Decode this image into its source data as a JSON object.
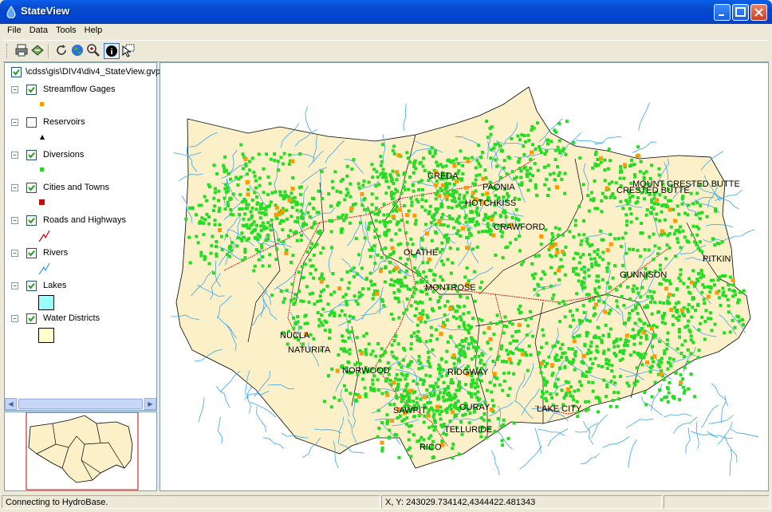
{
  "window": {
    "title": "StateView"
  },
  "menu": [
    "File",
    "Data",
    "Tools",
    "Help"
  ],
  "toolbar": {
    "buttons": [
      "print-icon",
      "export-icon",
      "refresh-icon",
      "globe-icon",
      "zoom-icon",
      "info-icon",
      "select-icon"
    ]
  },
  "legend": {
    "root": "\\cdss\\gis\\DIV4\\div4_StateView.gvp",
    "layers": [
      {
        "name": "Streamflow Gages",
        "checked": true,
        "symbol": "point",
        "color": "#ff9900"
      },
      {
        "name": "Reservoirs",
        "checked": false,
        "symbol": "triangle",
        "color": "#000000"
      },
      {
        "name": "Diversions",
        "checked": true,
        "symbol": "point",
        "color": "#33cc33"
      },
      {
        "name": "Cities and Towns",
        "checked": true,
        "symbol": "square",
        "color": "#dd0000"
      },
      {
        "name": "Roads and Highways",
        "checked": true,
        "symbol": "line",
        "color": "#cc0000"
      },
      {
        "name": "Rivers",
        "checked": true,
        "symbol": "line",
        "color": "#3399ff"
      },
      {
        "name": "Lakes",
        "checked": true,
        "symbol": "fill",
        "color": "#99ffff"
      },
      {
        "name": "Water Districts",
        "checked": true,
        "symbol": "fill",
        "color": "#ffffcc"
      }
    ]
  },
  "map": {
    "labels": [
      "CREDA",
      "PAONIA",
      "HOTCHKISS",
      "CRAWFORD",
      "OLATHE",
      "MONTROSE",
      "NUCLA",
      "NATURITA",
      "NORWOOD",
      "RIDGWAY",
      "OURAY",
      "LAKE CITY",
      "TELLURIDE",
      "SAWPIT",
      "RICO",
      "MOUNT CRESTED BUTTE",
      "CRESTED BUTTE",
      "PITKIN",
      "GUNNISON"
    ],
    "colors": {
      "district": "#fbf0c8",
      "diversion": "#22dd22",
      "river": "#3aa6ee",
      "gage": "#ff9900",
      "road": "#cc0000"
    }
  },
  "status": {
    "message": "Connecting to HydroBase.",
    "coords": "X, Y:  243029.734142,4344422.481343",
    "extra": ""
  }
}
